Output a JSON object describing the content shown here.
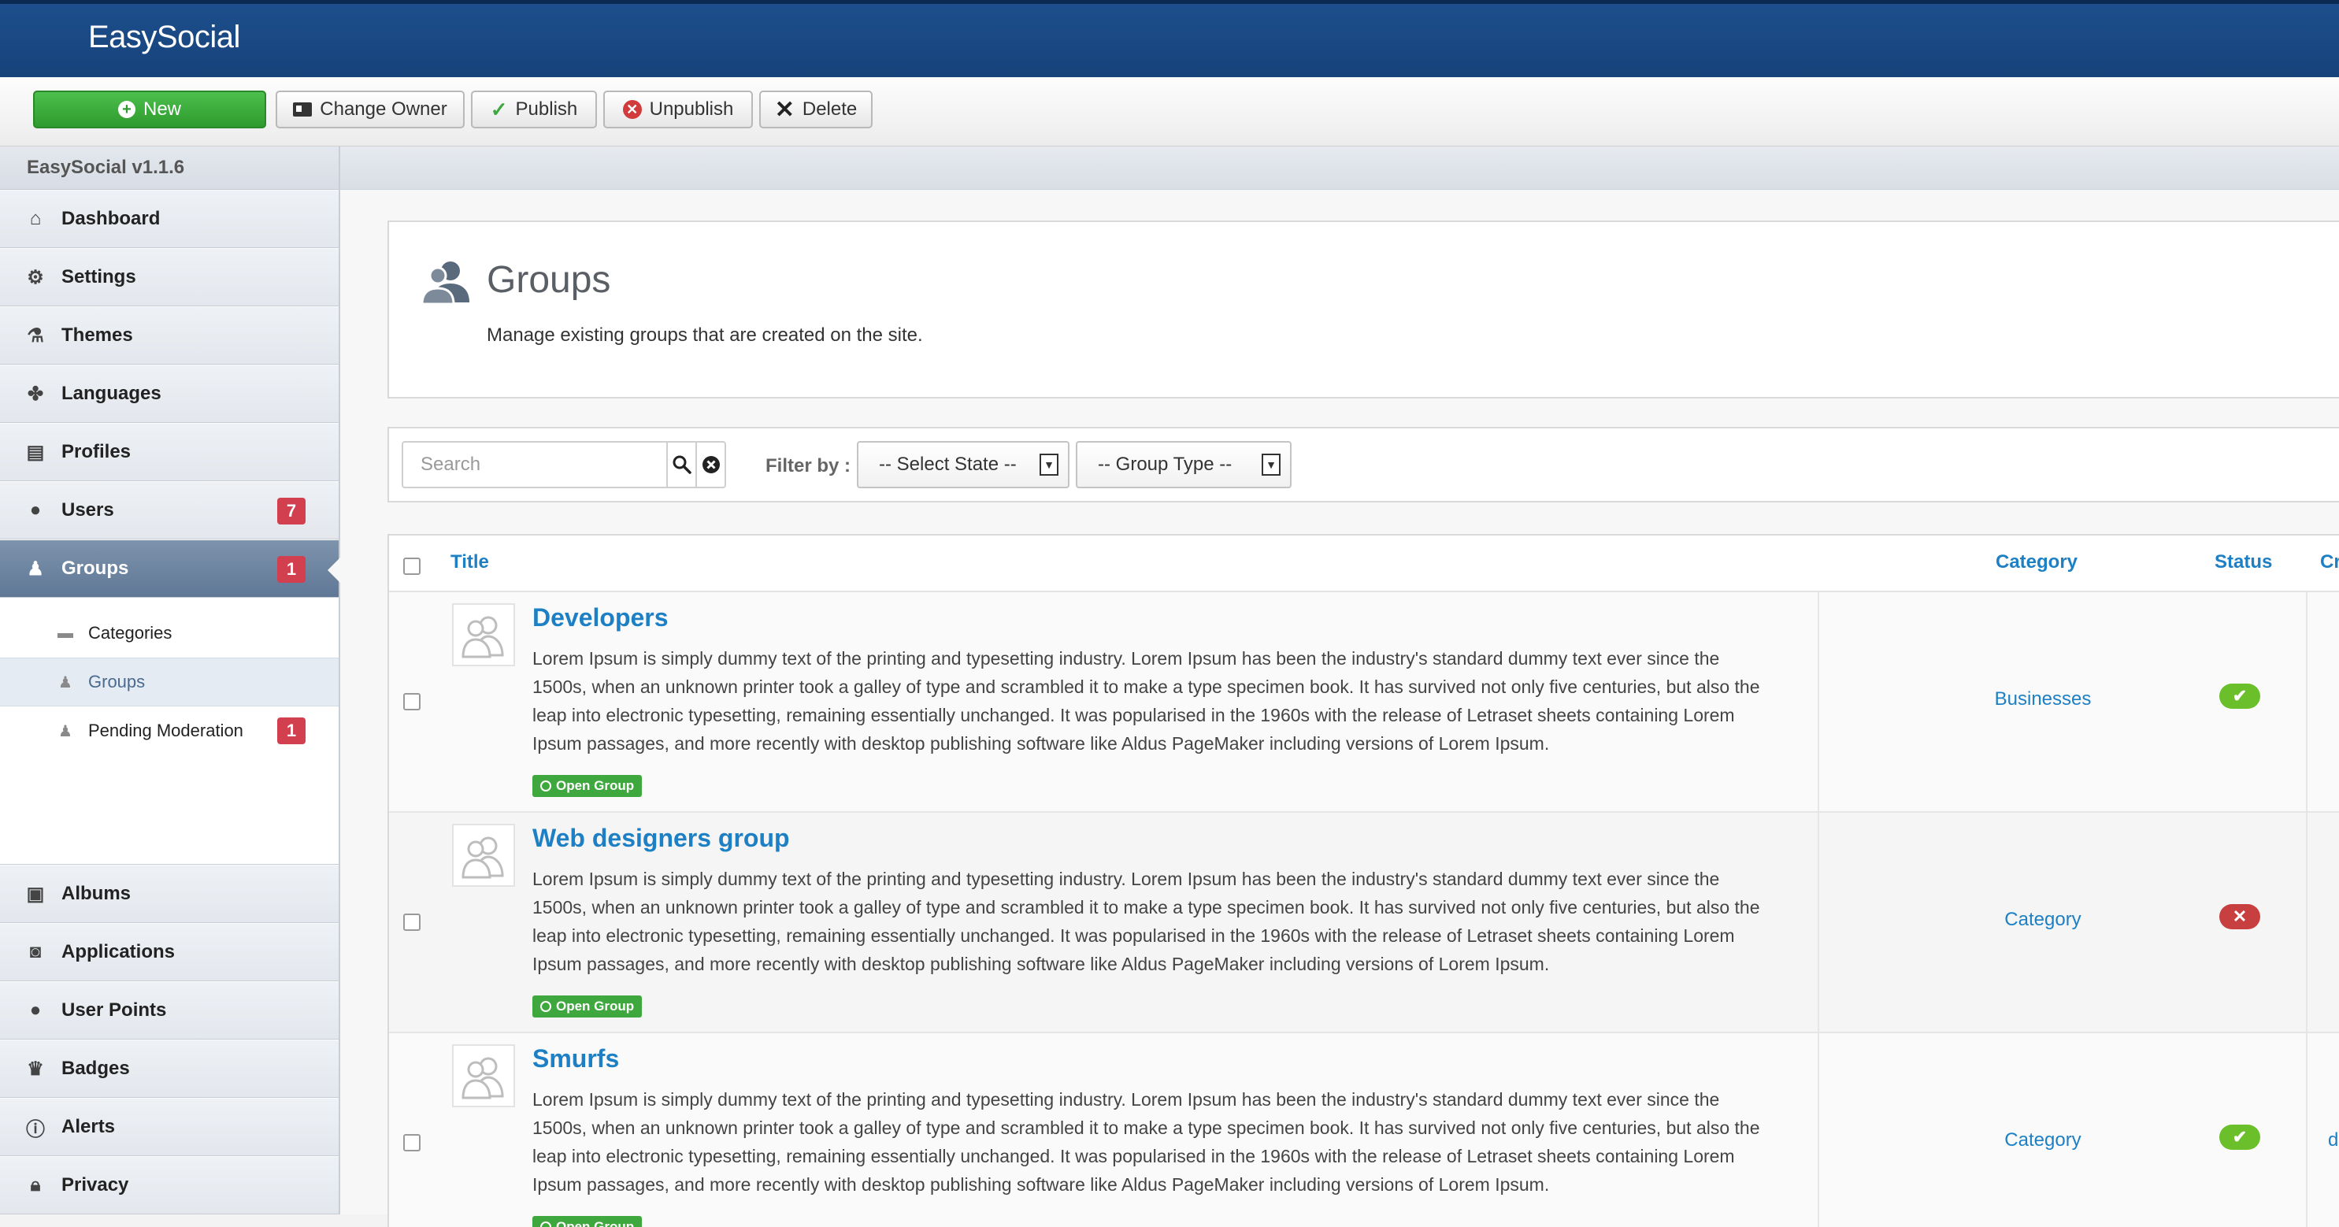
{
  "app": {
    "title": "EasySocial"
  },
  "toolbar": {
    "new_label": "New",
    "change_owner_label": "Change Owner",
    "publish_label": "Publish",
    "unpublish_label": "Unpublish",
    "delete_label": "Delete"
  },
  "sidebar": {
    "version": "EasySocial v1.1.6",
    "items_top": [
      {
        "label": "Dashboard",
        "icon": "home-icon"
      },
      {
        "label": "Settings",
        "icon": "gear-icon"
      },
      {
        "label": "Themes",
        "icon": "flask-icon"
      },
      {
        "label": "Languages",
        "icon": "puzzle-icon"
      },
      {
        "label": "Profiles",
        "icon": "id-card-icon"
      },
      {
        "label": "Users",
        "icon": "user-icon",
        "badge": "7"
      },
      {
        "label": "Groups",
        "icon": "group-icon",
        "badge": "1",
        "active": true
      }
    ],
    "sub_items": [
      {
        "label": "Categories",
        "icon": "folder-icon"
      },
      {
        "label": "Groups",
        "icon": "group-icon",
        "active": true
      },
      {
        "label": "Pending Moderation",
        "icon": "group-icon",
        "badge": "1"
      }
    ],
    "items_bottom": [
      {
        "label": "Albums",
        "icon": "albums-icon"
      },
      {
        "label": "Applications",
        "icon": "applications-icon"
      },
      {
        "label": "User Points",
        "icon": "circle-icon"
      },
      {
        "label": "Badges",
        "icon": "crown-icon"
      },
      {
        "label": "Alerts",
        "icon": "alert-icon"
      },
      {
        "label": "Privacy",
        "icon": "lock-icon"
      }
    ]
  },
  "page": {
    "title": "Groups",
    "description": "Manage existing groups that are created on the site."
  },
  "filters": {
    "search_placeholder": "Search",
    "filter_label": "Filter by :",
    "state_selected": "-- Select State --",
    "type_selected": "-- Group Type --"
  },
  "table": {
    "columns": {
      "title": "Title",
      "category": "Category",
      "status": "Status",
      "created": "Cr"
    },
    "rows": [
      {
        "title": "Developers",
        "description": "Lorem Ipsum is simply dummy text of the printing and typesetting industry. Lorem Ipsum has been the industry's standard dummy text ever since the 1500s, when an unknown printer took a galley of type and scrambled it to make a type specimen book. It has survived not only five centuries, but also the leap into electronic typesetting, remaining essentially unchanged. It was popularised in the 1960s with the release of Letraset sheets containing Lorem Ipsum passages, and more recently with desktop publishing software like Aldus PageMaker including versions of Lorem Ipsum.",
        "tag": "Open Group",
        "category": "Businesses",
        "status": "published",
        "created": ""
      },
      {
        "title": "Web designers group",
        "description": "Lorem Ipsum is simply dummy text of the printing and typesetting industry. Lorem Ipsum has been the industry's standard dummy text ever since the 1500s, when an unknown printer took a galley of type and scrambled it to make a type specimen book. It has survived not only five centuries, but also the leap into electronic typesetting, remaining essentially unchanged. It was popularised in the 1960s with the release of Letraset sheets containing Lorem Ipsum passages, and more recently with desktop publishing software like Aldus PageMaker including versions of Lorem Ipsum.",
        "tag": "Open Group",
        "category": "Category",
        "status": "unpublished",
        "created": ""
      },
      {
        "title": "Smurfs",
        "description": "Lorem Ipsum is simply dummy text of the printing and typesetting industry. Lorem Ipsum has been the industry's standard dummy text ever since the 1500s, when an unknown printer took a galley of type and scrambled it to make a type specimen book. It has survived not only five centuries, but also the leap into electronic typesetting, remaining essentially unchanged. It was popularised in the 1960s with the release of Letraset sheets containing Lorem Ipsum passages, and more recently with desktop publishing software like Aldus PageMaker including versions of Lorem Ipsum.",
        "tag": "Open Group",
        "category": "Category",
        "status": "published",
        "created": "d"
      }
    ]
  },
  "colors": {
    "brand_bar": "#17427a",
    "new_button": "#3ea83e",
    "link": "#1d7fc4",
    "badge": "#d23f4f",
    "status_ok": "#6bbf2a",
    "status_bad": "#c83f3f",
    "sidebar_active": "#6b829e"
  }
}
